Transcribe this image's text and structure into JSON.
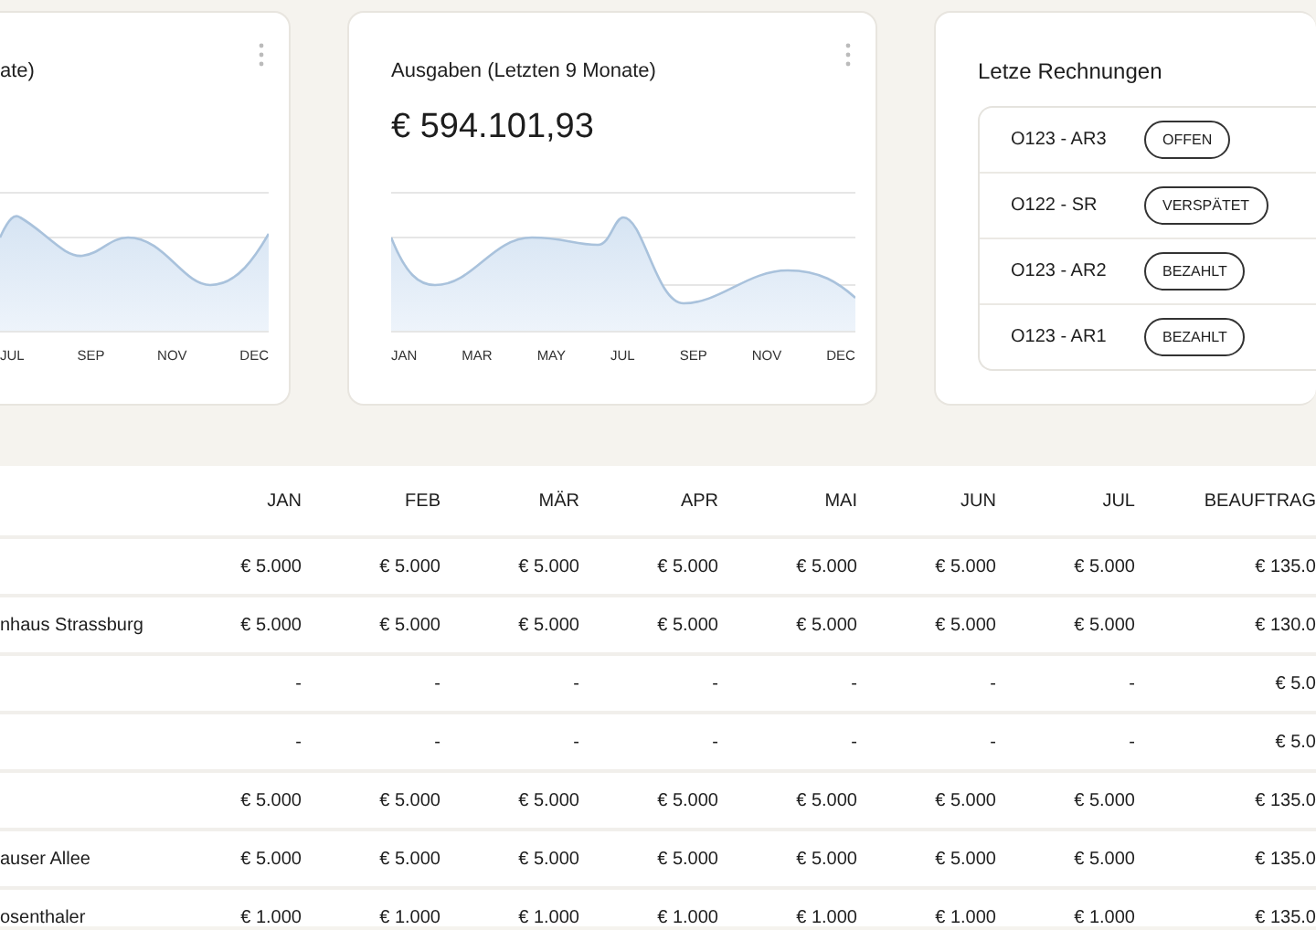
{
  "cards": [
    {
      "kind": "chart",
      "title": "ate)",
      "x_labels": [
        "JUL",
        "SEP",
        "NOV",
        "DEC"
      ]
    },
    {
      "kind": "chart",
      "title": "Ausgaben (Letzten 9 Monate)",
      "value": "€ 594.101,93",
      "x_labels": [
        "JAN",
        "MAR",
        "MAY",
        "JUL",
        "SEP",
        "NOV",
        "DEC"
      ]
    },
    {
      "kind": "invoices",
      "title": "Letze Rechnungen",
      "invoices": [
        {
          "id": "O123 - AR3",
          "status": "OFFEN"
        },
        {
          "id": "O122 - SR",
          "status": "VERSPÄTET"
        },
        {
          "id": "O123 - AR2",
          "status": "BEZAHLT"
        },
        {
          "id": "O123 - AR1",
          "status": "BEZAHLT"
        }
      ]
    }
  ],
  "table": {
    "columns": [
      "JAN",
      "FEB",
      "MÄR",
      "APR",
      "MAI",
      "JUN",
      "JUL",
      "BEAUFTRAG"
    ],
    "rows": [
      {
        "name": "",
        "cells": [
          "€ 5.000",
          "€ 5.000",
          "€ 5.000",
          "€ 5.000",
          "€ 5.000",
          "€ 5.000",
          "€ 5.000",
          "€ 135.0"
        ]
      },
      {
        "name": "nhaus Strassburg",
        "cells": [
          "€ 5.000",
          "€ 5.000",
          "€ 5.000",
          "€ 5.000",
          "€ 5.000",
          "€ 5.000",
          "€ 5.000",
          "€ 130.0"
        ]
      },
      {
        "name": "",
        "cells": [
          "-",
          "-",
          "-",
          "-",
          "-",
          "-",
          "-",
          "€ 5.0"
        ]
      },
      {
        "name": "",
        "cells": [
          "-",
          "-",
          "-",
          "-",
          "-",
          "-",
          "-",
          "€ 5.0"
        ]
      },
      {
        "name": "",
        "cells": [
          "€ 5.000",
          "€ 5.000",
          "€ 5.000",
          "€ 5.000",
          "€ 5.000",
          "€ 5.000",
          "€ 5.000",
          "€ 135.0"
        ]
      },
      {
        "name": "auser Allee",
        "cells": [
          "€ 5.000",
          "€ 5.000",
          "€ 5.000",
          "€ 5.000",
          "€ 5.000",
          "€ 5.000",
          "€ 5.000",
          "€ 135.0"
        ]
      },
      {
        "name": "osenthaler",
        "cells": [
          "€ 1.000",
          "€ 1.000",
          "€ 1.000",
          "€ 1.000",
          "€ 1.000",
          "€ 1.000",
          "€ 1.000",
          "€ 135.0"
        ]
      }
    ]
  }
}
